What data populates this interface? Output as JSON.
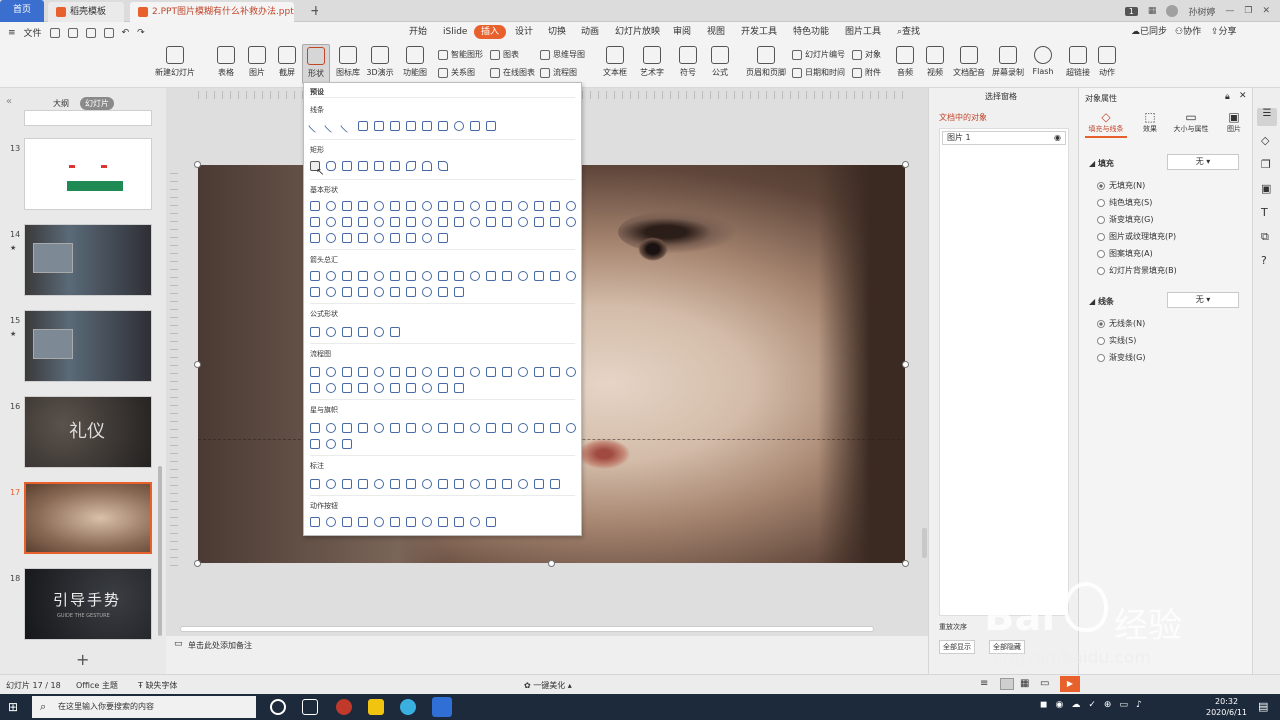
{
  "titlebar": {
    "home_tab": "首页",
    "template_tab": "稻壳模板",
    "doc_tab": "2.PPT图片模糊有什么补救办法.pptx",
    "page_badge": "1",
    "user": "孙树婷"
  },
  "menubar": {
    "file": "文件",
    "tabs": [
      "开始",
      "iSlide",
      "插入",
      "设计",
      "切换",
      "动画",
      "幻灯片放映",
      "审阅",
      "视图",
      "开发工具",
      "特色功能",
      "图片工具"
    ],
    "active_tab": "插入",
    "search": "查找",
    "sync": "已同步",
    "collab": "协作",
    "share": "分享"
  },
  "ribbon": {
    "buttons": [
      "新建幻灯片",
      "表格",
      "图片",
      "截屏",
      "形状",
      "图标库",
      "3D演示",
      "功能图",
      "文本框",
      "艺术字",
      "符号",
      "公式",
      "页眉和页脚",
      "音频",
      "视频",
      "文档配音",
      "屏幕录制",
      "Flash",
      "超链接",
      "动作"
    ],
    "small": [
      "智能图形",
      "图表",
      "思维导图",
      "关系图",
      "在线图表",
      "流程图",
      "幻灯片编号",
      "对象",
      "日期和时间",
      "附件"
    ]
  },
  "left_panel": {
    "tabs": [
      "大纲",
      "幻灯片"
    ],
    "active_tab": "幻灯片",
    "slide_numbers": [
      "13",
      "14",
      "15",
      "16",
      "17",
      "18"
    ],
    "thumb16_title": "礼仪",
    "thumb18_title": "引导手势",
    "thumb18_subtitle": "GUIDE THE GESTURE",
    "add": "+"
  },
  "shape_menu": {
    "header": "预设",
    "sections": [
      "线条",
      "矩形",
      "基本形状",
      "箭头总汇",
      "公式形状",
      "流程图",
      "星与旗帜",
      "标注",
      "动作按钮"
    ]
  },
  "notes": {
    "placeholder": "单击此处添加备注"
  },
  "selection_pane": {
    "title": "选择窗格",
    "subtitle": "文档中的对象",
    "item": "图片 1",
    "reorder": "重放次序",
    "show_all": "全部显示",
    "hide_all": "全部隐藏"
  },
  "props": {
    "title": "对象属性",
    "tabs": [
      "填充与线条",
      "效果",
      "大小与属性",
      "图片"
    ],
    "fill_label": "填充",
    "fill_value": "无",
    "fill_options": [
      "无填充(N)",
      "纯色填充(S)",
      "渐变填充(G)",
      "图片或纹理填充(P)",
      "图案填充(A)",
      "幻灯片背景填充(B)"
    ],
    "line_label": "线条",
    "line_value": "无",
    "line_options": [
      "无线条(N)",
      "实线(S)",
      "渐变线(G)"
    ],
    "accent": "#e8612c"
  },
  "statusbar": {
    "slide_info": "幻灯片 17 / 18",
    "theme": "Office 主题",
    "font": "缺失字体",
    "beautify": "一键美化"
  },
  "taskbar": {
    "search_placeholder": "在这里输入你要搜索的内容",
    "time": "20:32",
    "date": "2020/6/11"
  },
  "watermark": {
    "brand": "Bai",
    "brand_cn": "经验",
    "url": "jingyan.baidu.com"
  }
}
